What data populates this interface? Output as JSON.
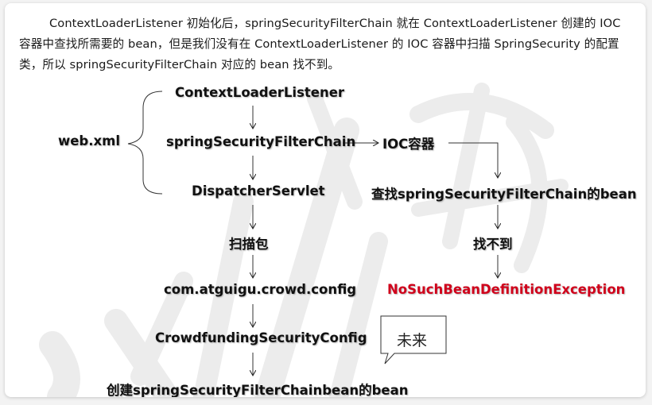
{
  "paragraph": "ContextLoaderListener 初始化后，springSecurityFilterChain 就在 ContextLoaderListener 创建的 IOC 容器中查找所需要的 bean，但是我们没有在 ContextLoaderListener 的 IOC 容器中扫描 SpringSecurity 的配置类，所以 springSecurityFilterChain 对应的 bean 找不到。",
  "diagram": {
    "web_xml": "web.xml",
    "context_loader_listener": "ContextLoaderListener",
    "spring_security_filter_chain": "springSecurityFilterChain",
    "ioc_container": "IOC容器",
    "dispatcher_servlet": "DispatcherServlet",
    "find_filter_chain_bean": "查找springSecurityFilterChain的bean",
    "scan_package": "扫描包",
    "not_found": "找不到",
    "config_package": "com.atguigu.crowd.config",
    "exception": "NoSuchBeanDefinitionException",
    "security_config": "CrowdfundingSecurityConfig",
    "create_bean": "创建springSecurityFilterChainbean的bean",
    "callout": "未来"
  },
  "colors": {
    "text": "#111111",
    "exception": "#d0021b",
    "watermark": "#ececec",
    "background": "#ffffff"
  }
}
